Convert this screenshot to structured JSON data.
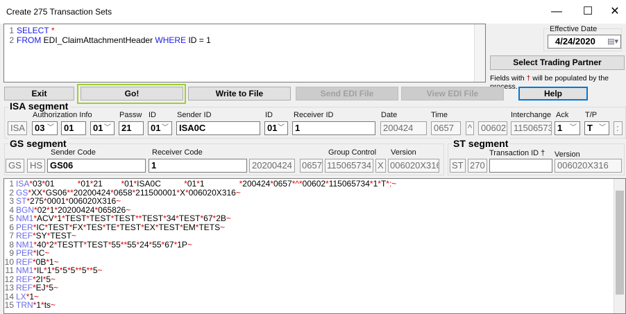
{
  "window": {
    "title": "Create 275 Transaction Sets",
    "minimize": "—",
    "maximize": "☐",
    "close": "✕"
  },
  "query": {
    "lines": [
      [
        "SELECT",
        "*"
      ],
      [
        "FROM",
        "EDI_ClaimAttachmentHeader",
        "WHERE",
        "ID = 1"
      ]
    ]
  },
  "effective_date": {
    "label": "Effective Date",
    "value": "4/24/2020"
  },
  "select_trading_partner": "Select Trading Partner",
  "note": {
    "prefix": "Fields with ",
    "dagger": "†",
    "suffix": " will be populated by the process."
  },
  "buttons": {
    "exit": "Exit",
    "go": "Go!",
    "write": "Write to File",
    "send": "Send EDI File",
    "view": "View EDI File",
    "help": "Help"
  },
  "isa": {
    "title": "ISA segment",
    "labels": {
      "auth": "Authorization Info",
      "passw": "Passw",
      "id1": "ID",
      "sender": "Sender ID",
      "id2": "ID",
      "receiver": "Receiver ID",
      "date": "Date",
      "time": "Time",
      "interchange": "Interchange",
      "ack": "Ack",
      "tp": "T/P"
    },
    "values": {
      "tag": "ISA",
      "auth_qual": "03",
      "auth": "01",
      "pass_qual": "01",
      "passw": "21",
      "sender_qual": "01",
      "sender": "ISA0C",
      "receiver_qual": "01",
      "receiver": "1",
      "date": "200424",
      "time": "0657",
      "rep": "^",
      "version": "00602",
      "control": "115065734",
      "ack": "1",
      "tp": "T",
      "sep": ":"
    }
  },
  "gs": {
    "title": "GS segment",
    "labels": {
      "sender": "Sender Code",
      "receiver": "Receiver Code",
      "group": "Group Control",
      "version": "Version"
    },
    "values": {
      "tag": "GS",
      "code": "HS",
      "sender": "GS06",
      "receiver": "1",
      "date": "20200424",
      "time": "0657",
      "group": "115065734",
      "agency": "X",
      "version": "006020X316"
    }
  },
  "st": {
    "title": "ST segment",
    "labels": {
      "txid": "Transaction ID †",
      "version": "Version"
    },
    "values": {
      "tag": "ST",
      "code": "270",
      "txid": "",
      "version": "006020X316"
    }
  },
  "output": [
    "ISA*03*01          *01*21        *01*ISA0C          *01*1               *200424*0657*^*00602*115065734*1*T*:~",
    "GS*XX*GS06**20200424*0658*211500001*X*006020X316~",
    "ST*275*0001*006020X316~",
    "BGN*02*1*20200424*065826~",
    "NM1*ACV*1*TEST*TEST*TEST**TEST*34*TEST*67*2B~",
    "PER*IC*TEST*FX*TES*TE*TEST*EX*TEST*EM*TETS~",
    "REF*SY*TEST~",
    "NM1*40*2*TESTT*TEST*55**55*24*55*67*1P~",
    "PER*IC~",
    "REF*0B*1~",
    "NM1*IL*1*5*5*5**5**5~",
    "REF*2I*5~",
    "REF*EJ*5~",
    "LX*1~",
    "TRN*1*ts~"
  ],
  "colors": {
    "segment": "#6a6ae8",
    "delimiter": "#e00000",
    "keyword": "#1a1ae6",
    "go_highlight": "#a0d030",
    "help_border": "#0078d7"
  }
}
